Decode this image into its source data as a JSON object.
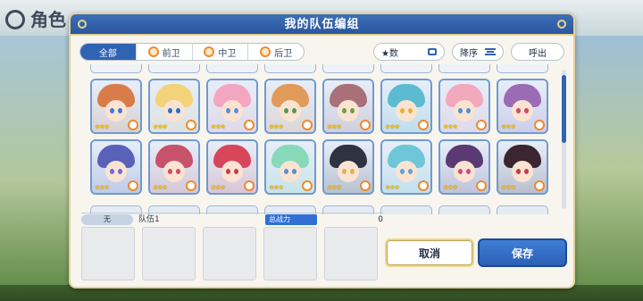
{
  "background": {
    "screen_title": "角色"
  },
  "dialog": {
    "title": "我的队伍编组"
  },
  "filters": {
    "tabs": [
      {
        "label": "全部",
        "active": true
      },
      {
        "label": "前卫",
        "icon": "position-icon"
      },
      {
        "label": "中卫",
        "icon": "position-icon"
      },
      {
        "label": "后卫",
        "icon": "position-icon"
      }
    ]
  },
  "controls": {
    "sort_key": "★数",
    "sort_order": "降序",
    "callout": "呼出"
  },
  "roster": {
    "rows": [
      [
        {
          "hair": "#d97c4a",
          "eyes": "#3a7bd5",
          "stars": "★★★"
        },
        {
          "hair": "#f3d27c",
          "eyes": "#2c6fc9",
          "stars": "★★★"
        },
        {
          "hair": "#f3a6c0",
          "eyes": "#5b8fd1",
          "stars": "★★★"
        },
        {
          "hair": "#e19a5a",
          "eyes": "#4f9a55",
          "stars": "★★★"
        },
        {
          "hair": "#a9707a",
          "eyes": "#6b9e4a",
          "stars": "★★★"
        },
        {
          "hair": "#5bbbd0",
          "eyes": "#e5b33a",
          "stars": "★★★"
        },
        {
          "hair": "#f2a8bd",
          "eyes": "#4d8fcf",
          "stars": "★★★"
        },
        {
          "hair": "#9b6bb6",
          "eyes": "#c94b6a",
          "stars": "★★★"
        }
      ],
      [
        {
          "hair": "#5a61b8",
          "eyes": "#6f6ad0",
          "stars": "★★★"
        },
        {
          "hair": "#c8526a",
          "eyes": "#d4486a",
          "stars": "★★★"
        },
        {
          "hair": "#d8465b",
          "eyes": "#c63b4f",
          "stars": "★★★"
        },
        {
          "hair": "#87d9b9",
          "eyes": "#4f93d4",
          "stars": "★★★"
        },
        {
          "hair": "#2f3240",
          "eyes": "#e0b14a",
          "stars": "★★★"
        },
        {
          "hair": "#6ec6d8",
          "eyes": "#5aa4d8",
          "stars": "★★★"
        },
        {
          "hair": "#5b3a73",
          "eyes": "#c84a8a",
          "stars": "★★★"
        },
        {
          "hair": "#3b2530",
          "eyes": "#c03c4c",
          "stars": "★★★"
        }
      ]
    ]
  },
  "team": {
    "badge": "无",
    "name": "队伍1",
    "power_label": "总战力",
    "power_value": "0"
  },
  "buttons": {
    "cancel": "取消",
    "save": "保存"
  }
}
